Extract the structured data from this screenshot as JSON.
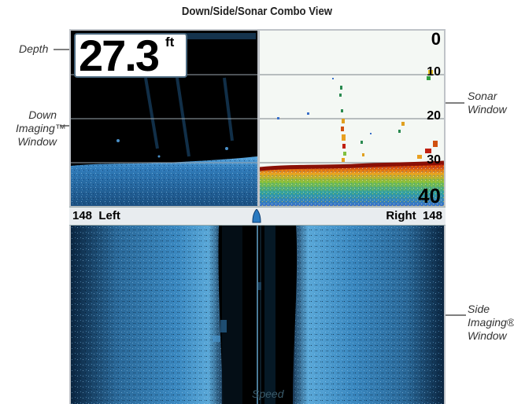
{
  "title": "Down/Side/Sonar Combo View",
  "callouts": {
    "depth": "Depth",
    "down_imaging": [
      "Down",
      "Imaging™",
      "Window"
    ],
    "sonar": [
      "Sonar",
      "Window"
    ],
    "side_imaging": [
      "Side",
      "Imaging®",
      "Window"
    ]
  },
  "depth_readout": {
    "value": "27.3",
    "unit": "ft"
  },
  "depth_scale": [
    "0",
    "10",
    "20",
    "30",
    "40"
  ],
  "status_bar": {
    "left": "148  Left",
    "right": "Right  148"
  },
  "side_overlay": "Speed",
  "colors": {
    "sonar_strong": "#c01808",
    "sonar_mid": "#e8a020",
    "sonar_weak": "#30a040",
    "imaging": "#3a8ac8",
    "boat_icon": "#2a7ac0"
  }
}
